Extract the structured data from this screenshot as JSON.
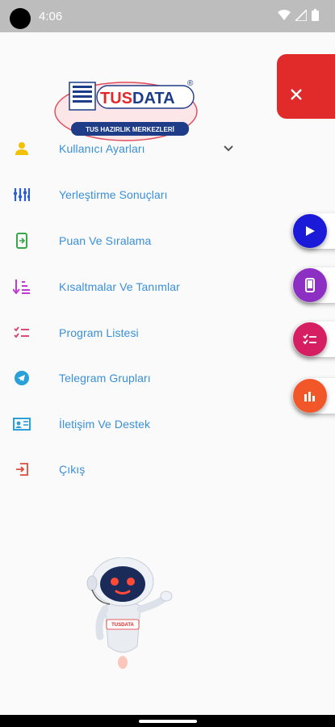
{
  "status_bar": {
    "time": "4:06",
    "icons": [
      "wifi-icon",
      "signal-icon",
      "battery-icon"
    ]
  },
  "logo": {
    "brand": "TUSDATA",
    "subtitle": "TUS HAZIRLIK MERKEZLERİ",
    "registered": "®"
  },
  "menu": {
    "items": [
      {
        "label": "Kullanıcı Ayarları",
        "icon": "user-icon",
        "color": "#f2c200"
      },
      {
        "label": "Yerleştirme Sonuçları",
        "icon": "sliders-icon",
        "color": "#2b5fd9"
      },
      {
        "label": "Puan Ve Sıralama",
        "icon": "phone-arrow-icon",
        "color": "#3aa64a"
      },
      {
        "label": "Kısaltmalar Ve Tanımlar",
        "icon": "sort-icon",
        "color": "#c23ad6"
      },
      {
        "label": "Program Listesi",
        "icon": "checklist-icon",
        "color": "#d63a66"
      },
      {
        "label": "Telegram Grupları",
        "icon": "telegram-icon",
        "color": "#2a9fd8"
      },
      {
        "label": "İletişim Ve Destek",
        "icon": "contact-card-icon",
        "color": "#2a9fd8"
      },
      {
        "label": "Çıkış",
        "icon": "logout-icon",
        "color": "#e14a3a"
      }
    ]
  },
  "colors": {
    "label": "#3a8fd8",
    "close_panel": "#e12a2a",
    "fab_play": "#1a1ad8",
    "fab_phone": "#8e2fc4",
    "fab_list": "#d61f63",
    "fab_chart": "#f2572a"
  },
  "fabs": [
    "play-icon",
    "phone-icon",
    "checklist-icon",
    "bar-chart-icon"
  ],
  "mascot": {
    "badge": "TUSDATA"
  }
}
